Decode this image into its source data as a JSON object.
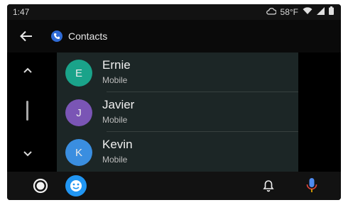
{
  "status_bar": {
    "time": "1:47",
    "temperature": "58°F",
    "icons": [
      "cloud-icon",
      "wifi-icon",
      "cellular-signal-icon",
      "battery-icon"
    ]
  },
  "header": {
    "title": "Contacts",
    "back_icon": "back-arrow-icon",
    "app_icon": "phone-app-icon"
  },
  "scroll_rail": {
    "up_icon": "chevron-up-icon",
    "down_icon": "chevron-down-icon"
  },
  "contacts": [
    {
      "initial": "E",
      "name": "Ernie",
      "label": "Mobile",
      "avatar_color": "#1aa38a"
    },
    {
      "initial": "J",
      "name": "Javier",
      "label": "Mobile",
      "avatar_color": "#7a55b5"
    },
    {
      "initial": "K",
      "name": "Kevin",
      "label": "Mobile",
      "avatar_color": "#3a8ee0"
    }
  ],
  "bottom_bar": {
    "icons": [
      "home-icon",
      "assistant-icon",
      "notifications-bell-icon",
      "microphone-icon"
    ]
  },
  "colors": {
    "background": "#000000",
    "list_background": "#1c2626",
    "accent": "#2196f3",
    "mic": "#4f8bf0"
  }
}
